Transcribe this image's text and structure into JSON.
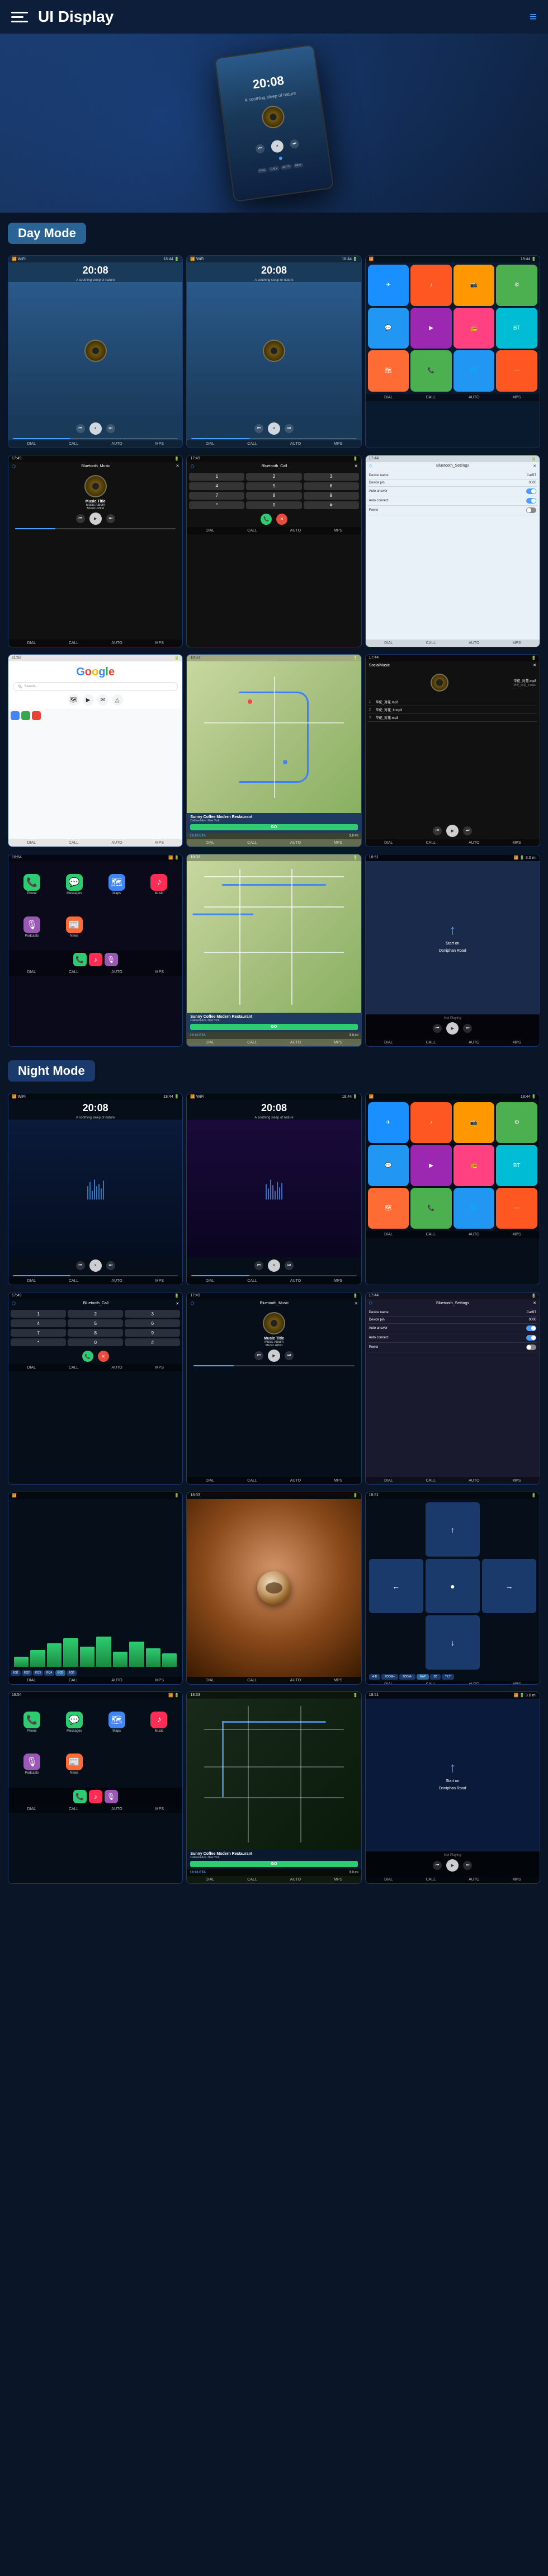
{
  "header": {
    "title": "UI Display",
    "menu_icon": "menu-icon",
    "nav_icon": "≡"
  },
  "sections": {
    "day_mode": "Day Mode",
    "night_mode": "Night Mode"
  },
  "screens": {
    "time": "20:08",
    "subtitle1": "A soothing sleep of nature",
    "subtitle2": "A soothing sleep of nature",
    "music_title": "Music Title",
    "music_album": "Music Album",
    "music_artist": "Music Artist",
    "bluetooth_music": "Bluetooth_Music",
    "bluetooth_call": "Bluetooth_Call",
    "bluetooth_settings": "Bluetooth_Settings",
    "device_name_label": "Device name",
    "device_name_val": "CarBT",
    "device_pin_label": "Device pin",
    "device_pin_val": "0000",
    "auto_answer_label": "Auto answer",
    "auto_connect_label": "Auto connect",
    "power_label": "Power",
    "google_text": "Google",
    "search_placeholder": "Search...",
    "nav_destination": "Sunny Coffee Modern Restaurant",
    "nav_address": "Oakland Ave. New York",
    "nav_eta": "18:16 ETA",
    "nav_distance": "3.9 mi",
    "go_label": "GO",
    "not_playing": "Not Playing",
    "start_on": "Start on",
    "doniphan": "Doniphan Road",
    "social_songs": [
      "华佗_对花.mp3",
      "华佗_对花_II.mp3",
      "华佗_对花.mp3"
    ],
    "bottom_nav_items": [
      "DIAL",
      "CALL",
      "AUTO",
      "MPS"
    ],
    "call_keys": [
      "1",
      "2",
      "3",
      "4",
      "5",
      "6",
      "7",
      "8",
      "9",
      "*",
      "0",
      "#"
    ]
  },
  "colors": {
    "primary_blue": "#1a3a6b",
    "accent_blue": "#4a9eff",
    "day_bg": "#1a3a5a",
    "night_bg": "#060e1a",
    "green": "#2ecc71",
    "section_badge": "#2a6496"
  }
}
